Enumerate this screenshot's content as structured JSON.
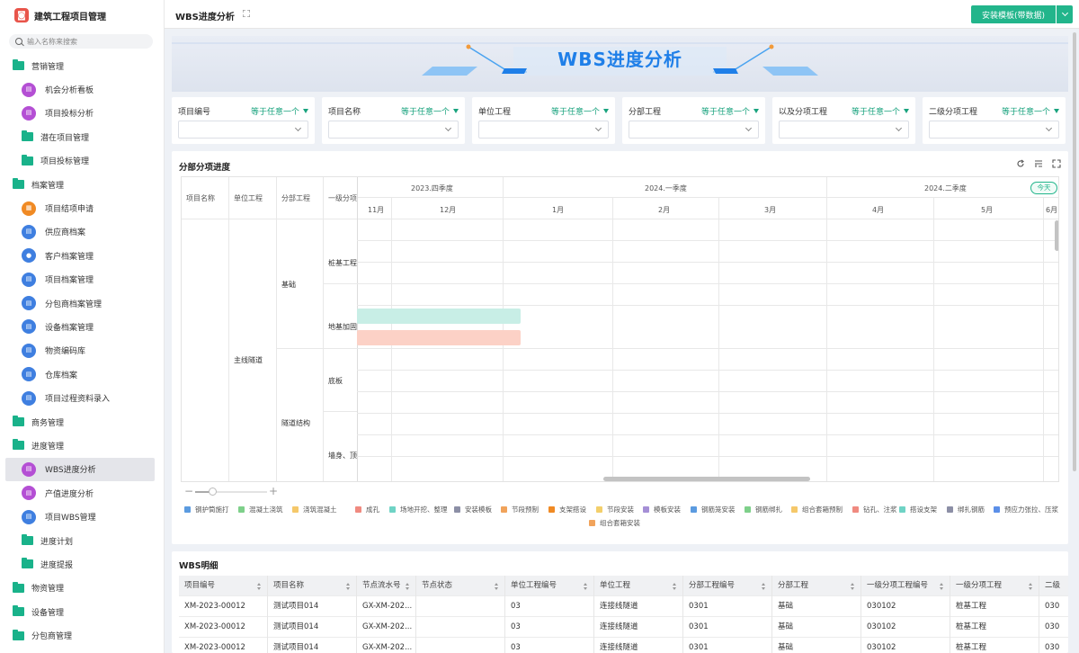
{
  "app": {
    "title": "建筑工程项目管理",
    "logo_glyph": "◙"
  },
  "search": {
    "placeholder": "输入名称来搜索"
  },
  "sidebar": {
    "items": [
      {
        "label": "营销管理",
        "type": "group"
      },
      {
        "label": "机会分析看板",
        "type": "sub",
        "icon": "chart-board-icon",
        "color": "purple"
      },
      {
        "label": "项目投标分析",
        "type": "sub",
        "icon": "chart-board-icon",
        "color": "purple"
      },
      {
        "label": "潜在项目管理",
        "type": "sub-folder"
      },
      {
        "label": "项目投标管理",
        "type": "sub-folder"
      },
      {
        "label": "档案管理",
        "type": "group"
      },
      {
        "label": "项目结项申请",
        "type": "sub",
        "icon": "form-icon",
        "color": "orange"
      },
      {
        "label": "供应商档案",
        "type": "sub",
        "icon": "document-icon",
        "color": "blue"
      },
      {
        "label": "客户档案管理",
        "type": "sub",
        "icon": "user-icon",
        "color": "blue"
      },
      {
        "label": "项目档案管理",
        "type": "sub",
        "icon": "document-icon",
        "color": "blue"
      },
      {
        "label": "分包商档案管理",
        "type": "sub",
        "icon": "document-icon",
        "color": "blue"
      },
      {
        "label": "设备档案管理",
        "type": "sub",
        "icon": "document-icon",
        "color": "blue"
      },
      {
        "label": "物资编码库",
        "type": "sub",
        "icon": "document-icon",
        "color": "blue"
      },
      {
        "label": "仓库档案",
        "type": "sub",
        "icon": "document-icon",
        "color": "blue"
      },
      {
        "label": "项目过程资料录入",
        "type": "sub",
        "icon": "document-icon",
        "color": "blue"
      },
      {
        "label": "商务管理",
        "type": "group"
      },
      {
        "label": "进度管理",
        "type": "group"
      },
      {
        "label": "WBS进度分析",
        "type": "sub",
        "icon": "chart-board-icon",
        "color": "purple",
        "active": true
      },
      {
        "label": "产值进度分析",
        "type": "sub",
        "icon": "chart-board-icon",
        "color": "purple"
      },
      {
        "label": "项目WBS管理",
        "type": "sub",
        "icon": "document-icon",
        "color": "blue"
      },
      {
        "label": "进度计划",
        "type": "sub-folder"
      },
      {
        "label": "进度提报",
        "type": "sub-folder"
      },
      {
        "label": "物资管理",
        "type": "group"
      },
      {
        "label": "设备管理",
        "type": "group"
      },
      {
        "label": "分包商管理",
        "type": "group"
      }
    ]
  },
  "topbar": {
    "tab_title": "WBS进度分析",
    "install_label": "安装模板(带数据)"
  },
  "banner": {
    "title": "WBS进度分析"
  },
  "filters": [
    {
      "label": "项目编号",
      "op": "等于任意一个"
    },
    {
      "label": "项目名称",
      "op": "等于任意一个"
    },
    {
      "label": "单位工程",
      "op": "等于任意一个"
    },
    {
      "label": "分部工程",
      "op": "等于任意一个"
    },
    {
      "label": "以及分项工程",
      "op": "等于任意一个"
    },
    {
      "label": "二级分项工程",
      "op": "等于任意一个"
    }
  ],
  "gantt": {
    "title": "分部分项进度",
    "columns": [
      "项目名称",
      "单位工程",
      "分部工程",
      "一级分项"
    ],
    "quarters": [
      "2023.四季度",
      "2024.一季度",
      "2024.二季度"
    ],
    "months": [
      "11月",
      "12月",
      "1月",
      "2月",
      "3月",
      "4月",
      "5月",
      "6月"
    ],
    "today_label": "今天",
    "unit": "主线隧道",
    "divisions": [
      "基础",
      "隧道结构"
    ],
    "items": [
      "桩基工程",
      "地基加固",
      "底板",
      "墙身、顶"
    ]
  },
  "legend": [
    {
      "label": "钢护筒施打",
      "color": "#5b9be0"
    },
    {
      "label": "混凝土浇筑",
      "color": "#7ed08a"
    },
    {
      "label": "浇筑混凝土",
      "color": "#f5c86a"
    },
    {
      "label": "成孔",
      "color": "#f08a80"
    },
    {
      "label": "场地开挖、整理",
      "color": "#6fd3c5"
    },
    {
      "label": "安装模板",
      "color": "#8c8fa6"
    },
    {
      "label": "节段预制",
      "color": "#f1a35b"
    },
    {
      "label": "支架搭设",
      "color": "#f08a24"
    },
    {
      "label": "节段安装",
      "color": "#f3cf6b"
    },
    {
      "label": "模板安装",
      "color": "#a58fd6"
    },
    {
      "label": "钢筋笼安装",
      "color": "#5b9be0"
    },
    {
      "label": "钢筋绑扎",
      "color": "#7ed08a"
    },
    {
      "label": "组合套箱预制",
      "color": "#f5c86a"
    },
    {
      "label": "钻孔、注浆",
      "color": "#f08a80"
    },
    {
      "label": "搭设支架",
      "color": "#6fd3c5"
    },
    {
      "label": "绑扎钢筋",
      "color": "#8c8fa6"
    },
    {
      "label": "预应力张拉、压浆",
      "color": "#5b8fe8"
    },
    {
      "label": "组合套箱安装",
      "color": "#f1a35b"
    }
  ],
  "wbs": {
    "title": "WBS明细",
    "headers": [
      "项目编号",
      "项目名称",
      "节点流水号",
      "节点状态",
      "单位工程编号",
      "单位工程",
      "分部工程编号",
      "分部工程",
      "一级分项工程编号",
      "一级分项工程",
      "二级"
    ],
    "rows": [
      [
        "XM-2023-00012",
        "测试项目014",
        "GX-XM-202...",
        "",
        "03",
        "连接线隧道",
        "0301",
        "基础",
        "030102",
        "桩基工程",
        "030"
      ],
      [
        "XM-2023-00012",
        "测试项目014",
        "GX-XM-202...",
        "",
        "03",
        "连接线隧道",
        "0301",
        "基础",
        "030102",
        "桩基工程",
        "030"
      ],
      [
        "XM-2023-00012",
        "测试项目014",
        "GX-XM-202...",
        "",
        "03",
        "连接线隧道",
        "0301",
        "基础",
        "030102",
        "桩基工程",
        "030"
      ]
    ]
  }
}
